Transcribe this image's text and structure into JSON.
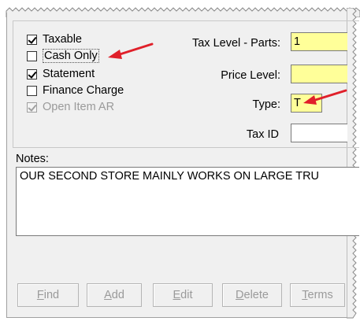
{
  "checkboxes": [
    {
      "label": "Taxable",
      "checked": true,
      "disabled": false
    },
    {
      "label": "Cash Only",
      "checked": false,
      "disabled": false
    },
    {
      "label": "Statement",
      "checked": true,
      "disabled": false
    },
    {
      "label": "Finance Charge",
      "checked": false,
      "disabled": false
    },
    {
      "label": "Open Item AR",
      "checked": true,
      "disabled": true
    }
  ],
  "fields": {
    "tax_level_parts": {
      "label": "Tax Level - Parts:",
      "value": "1"
    },
    "price_level": {
      "label": "Price Level:",
      "value": ""
    },
    "type": {
      "label": "Type:",
      "value": "T"
    },
    "tax_id": {
      "label": "Tax ID",
      "value": ""
    }
  },
  "notes": {
    "label": "Notes:",
    "value": "OUR SECOND STORE MAINLY WORKS ON LARGE TRU"
  },
  "buttons": {
    "find": {
      "underline": "F",
      "rest": "ind"
    },
    "add": {
      "underline": "A",
      "rest": "dd"
    },
    "edit": {
      "underline": "E",
      "rest": "dit"
    },
    "delete": {
      "underline": "D",
      "rest": "elete"
    },
    "terms": {
      "underline": "T",
      "rest": "erms"
    }
  },
  "colors": {
    "highlight_field": "#ffff99",
    "annotation_arrow": "#e0202a",
    "panel_bg": "#f0f0f0"
  }
}
